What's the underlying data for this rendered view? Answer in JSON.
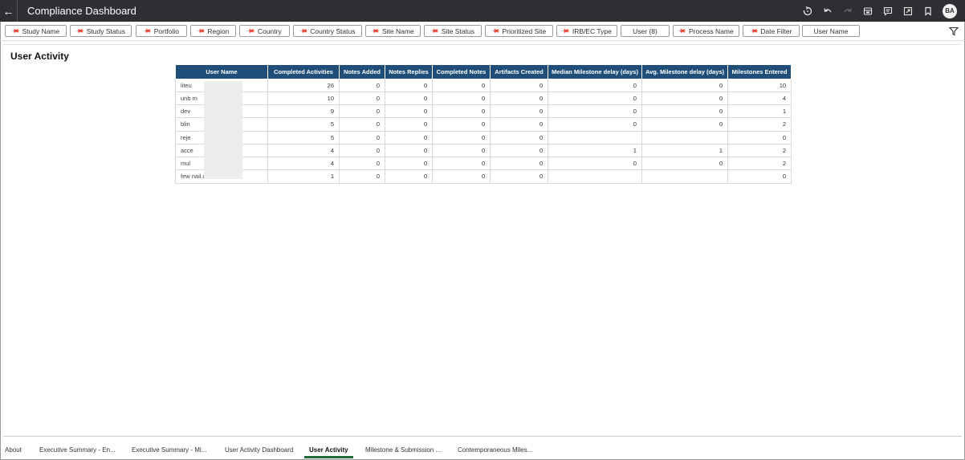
{
  "header": {
    "back_label": "←",
    "title": "Compliance Dashboard",
    "icons": [
      "reset-icon",
      "undo-icon",
      "redo-icon",
      "bookmark-manager-icon",
      "comments-icon",
      "present-icon",
      "bookmark-icon"
    ],
    "avatar_initials": "BA"
  },
  "filters": [
    {
      "label": "Study Name"
    },
    {
      "label": "Study Status"
    },
    {
      "label": "Portfolio"
    },
    {
      "label": "Region"
    },
    {
      "label": "Country"
    },
    {
      "label": "Country Status"
    },
    {
      "label": "Site Name"
    },
    {
      "label": "Site Status"
    },
    {
      "label": "Prioritized Site"
    },
    {
      "label": "IRB/EC Type"
    },
    {
      "label": "User (8)"
    },
    {
      "label": "Process Name"
    },
    {
      "label": "Date Filter"
    },
    {
      "label": "User Name"
    }
  ],
  "page": {
    "title": "User Activity"
  },
  "table": {
    "columns": [
      "User Name",
      "Completed Activities",
      "Notes Added",
      "Notes Replies",
      "Completed Notes",
      "Artifacts Created",
      "Median Milestone delay (days)",
      "Avg. Milestone delay (days)",
      "Milestones Entered"
    ],
    "rows": [
      [
        "liteu",
        "26",
        "0",
        "0",
        "0",
        "0",
        "0",
        "0",
        "10"
      ],
      [
        "unb                       m",
        "10",
        "0",
        "0",
        "0",
        "0",
        "0",
        "0",
        "4"
      ],
      [
        "dev",
        "9",
        "0",
        "0",
        "0",
        "0",
        "0",
        "0",
        "1"
      ],
      [
        "blin",
        "5",
        "0",
        "0",
        "0",
        "0",
        "0",
        "0",
        "2"
      ],
      [
        "reje",
        "5",
        "0",
        "0",
        "0",
        "0",
        "",
        "",
        "0"
      ],
      [
        "acce",
        "4",
        "0",
        "0",
        "0",
        "0",
        "1",
        "1",
        "2"
      ],
      [
        "mul",
        "4",
        "0",
        "0",
        "0",
        "0",
        "0",
        "0",
        "2"
      ],
      [
        "few                       nail.com",
        "1",
        "0",
        "0",
        "0",
        "0",
        "",
        "",
        "0"
      ]
    ]
  },
  "tabs": [
    {
      "label": "About",
      "active": false
    },
    {
      "label": "Executive Summary - En...",
      "active": false
    },
    {
      "label": "Executive Summary - Mi...",
      "active": false
    },
    {
      "label": "User Activity Dashboard",
      "active": false
    },
    {
      "label": "User Activity",
      "active": true
    },
    {
      "label": "Milestone & Submission ...",
      "active": false
    },
    {
      "label": "Contemporaneous Miles...",
      "active": false
    }
  ],
  "colors": {
    "titlebar_bg": "#2f2f33",
    "table_header_bg": "#1f4e79",
    "active_tab_underline": "#1f6b3a"
  }
}
